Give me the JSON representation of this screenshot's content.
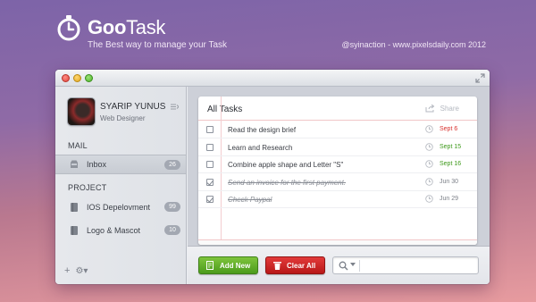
{
  "brand": {
    "name_bold": "Goo",
    "name_rest": "Task",
    "tagline": "The Best way to manage your Task",
    "credit": "@syinaction - www.pixelsdaily.com 2012"
  },
  "profile": {
    "name": "SYARIP YUNUS",
    "role": "Web Designer"
  },
  "sidebar": {
    "mail_label": "MAIL",
    "project_label": "PROJECT",
    "items": [
      {
        "label": "Inbox",
        "count": "26"
      },
      {
        "label": "IOS Depelovment",
        "count": "99"
      },
      {
        "label": "Logo & Mascot",
        "count": "10"
      }
    ],
    "footer_plus": "+",
    "footer_gear": "⚙▾"
  },
  "panel": {
    "title": "All Tasks",
    "share_label": "Share"
  },
  "tasks": [
    {
      "text": "Read the design brief",
      "due": "Sept 6",
      "done": false,
      "due_color": "#d9322f"
    },
    {
      "text": "Learn and Research",
      "due": "Sept 15",
      "done": false,
      "due_color": "#3f9a1c"
    },
    {
      "text": "Combine apple shape and Letter \"S\"",
      "due": "Sept 16",
      "done": false,
      "due_color": "#3f9a1c"
    },
    {
      "text": "Send an invoice for the first payment.",
      "due": "Jun 30",
      "done": true,
      "due_color": "#7b7f87"
    },
    {
      "text": "Check Paypal",
      "due": "Jun 29",
      "done": true,
      "due_color": "#7b7f87"
    }
  ],
  "toolbar": {
    "add_label": "Add New",
    "clear_label": "Clear All",
    "search_value": ""
  },
  "colors": {
    "accent_green": "#5aab25",
    "accent_red": "#c72020"
  }
}
